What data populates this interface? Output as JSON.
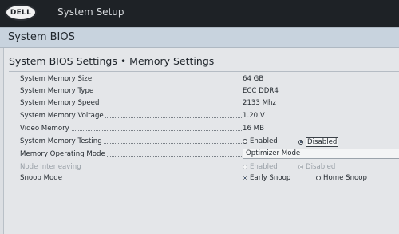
{
  "topbar": {
    "logo_text": "DELL",
    "app_title": "System Setup"
  },
  "header": {
    "title": "System BIOS"
  },
  "section": {
    "title": "System BIOS Settings • Memory Settings"
  },
  "settings": {
    "memory_size": {
      "label": "System Memory Size",
      "value": "64 GB"
    },
    "memory_type": {
      "label": "System Memory Type",
      "value": "ECC DDR4"
    },
    "memory_speed": {
      "label": "System Memory Speed",
      "value": "2133 Mhz"
    },
    "memory_voltage": {
      "label": "System Memory Voltage",
      "value": "1.20 V"
    },
    "video_memory": {
      "label": "Video Memory",
      "value": "16 MB"
    },
    "memory_testing": {
      "label": "System Memory Testing",
      "options": [
        "Enabled",
        "Disabled"
      ],
      "selected": "Disabled"
    },
    "operating_mode": {
      "label": "Memory Operating Mode",
      "value": "Optimizer Mode"
    },
    "node_interleaving": {
      "label": "Node Interleaving",
      "options": [
        "Enabled",
        "Disabled"
      ],
      "selected": "Disabled",
      "disabled": true
    },
    "snoop_mode": {
      "label": "Snoop Mode",
      "options": [
        "Early Snoop",
        "Home Snoop"
      ],
      "selected": "Early Snoop"
    }
  },
  "colors": {
    "topbar_bg": "#1e2226",
    "header_bg": "#c8d3de",
    "panel_bg": "#e4e6e9",
    "disabled_text": "#9aa1a8"
  }
}
